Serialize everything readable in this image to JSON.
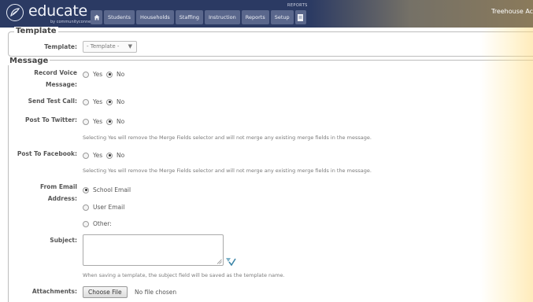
{
  "header": {
    "logo_text": "educate",
    "logo_sub": "by communityconnect",
    "reports_label": "REPORTS",
    "school_name": "Treehouse Ac",
    "nav": [
      "Students",
      "Households",
      "Staffing",
      "Instruction",
      "Reports",
      "Setup"
    ]
  },
  "template_section": {
    "legend": "Template",
    "label": "Template:",
    "selected": "- Template -"
  },
  "message_section": {
    "legend": "Message",
    "record_voice": {
      "label_line1": "Record Voice",
      "label_line2": "Message:",
      "yes": "Yes",
      "no": "No",
      "selected": "No"
    },
    "send_test_call": {
      "label": "Send Test Call:",
      "yes": "Yes",
      "no": "No",
      "selected": "No"
    },
    "post_twitter": {
      "label": "Post To Twitter:",
      "yes": "Yes",
      "no": "No",
      "selected": "No",
      "help": "Selecting Yes will remove the Merge Fields selector and will not merge any existing merge fields in the message."
    },
    "post_facebook": {
      "label": "Post To Facebook:",
      "yes": "Yes",
      "no": "No",
      "selected": "No",
      "help": "Selecting Yes will remove the Merge Fields selector and will not merge any existing merge fields in the message."
    },
    "from_email": {
      "label_line1": "From Email",
      "label_line2": "Address:",
      "options": [
        "School Email",
        "User Email",
        "Other:"
      ],
      "selected": "School Email"
    },
    "subject": {
      "label": "Subject:",
      "value": "",
      "help": "When saving a template, the subject field will be saved as the template name."
    },
    "attachments": {
      "label": "Attachments:",
      "button": "Choose File",
      "status": "No file chosen"
    }
  },
  "colors": {
    "topbar": "#2b3a63",
    "nav_item": "#5a678c"
  }
}
